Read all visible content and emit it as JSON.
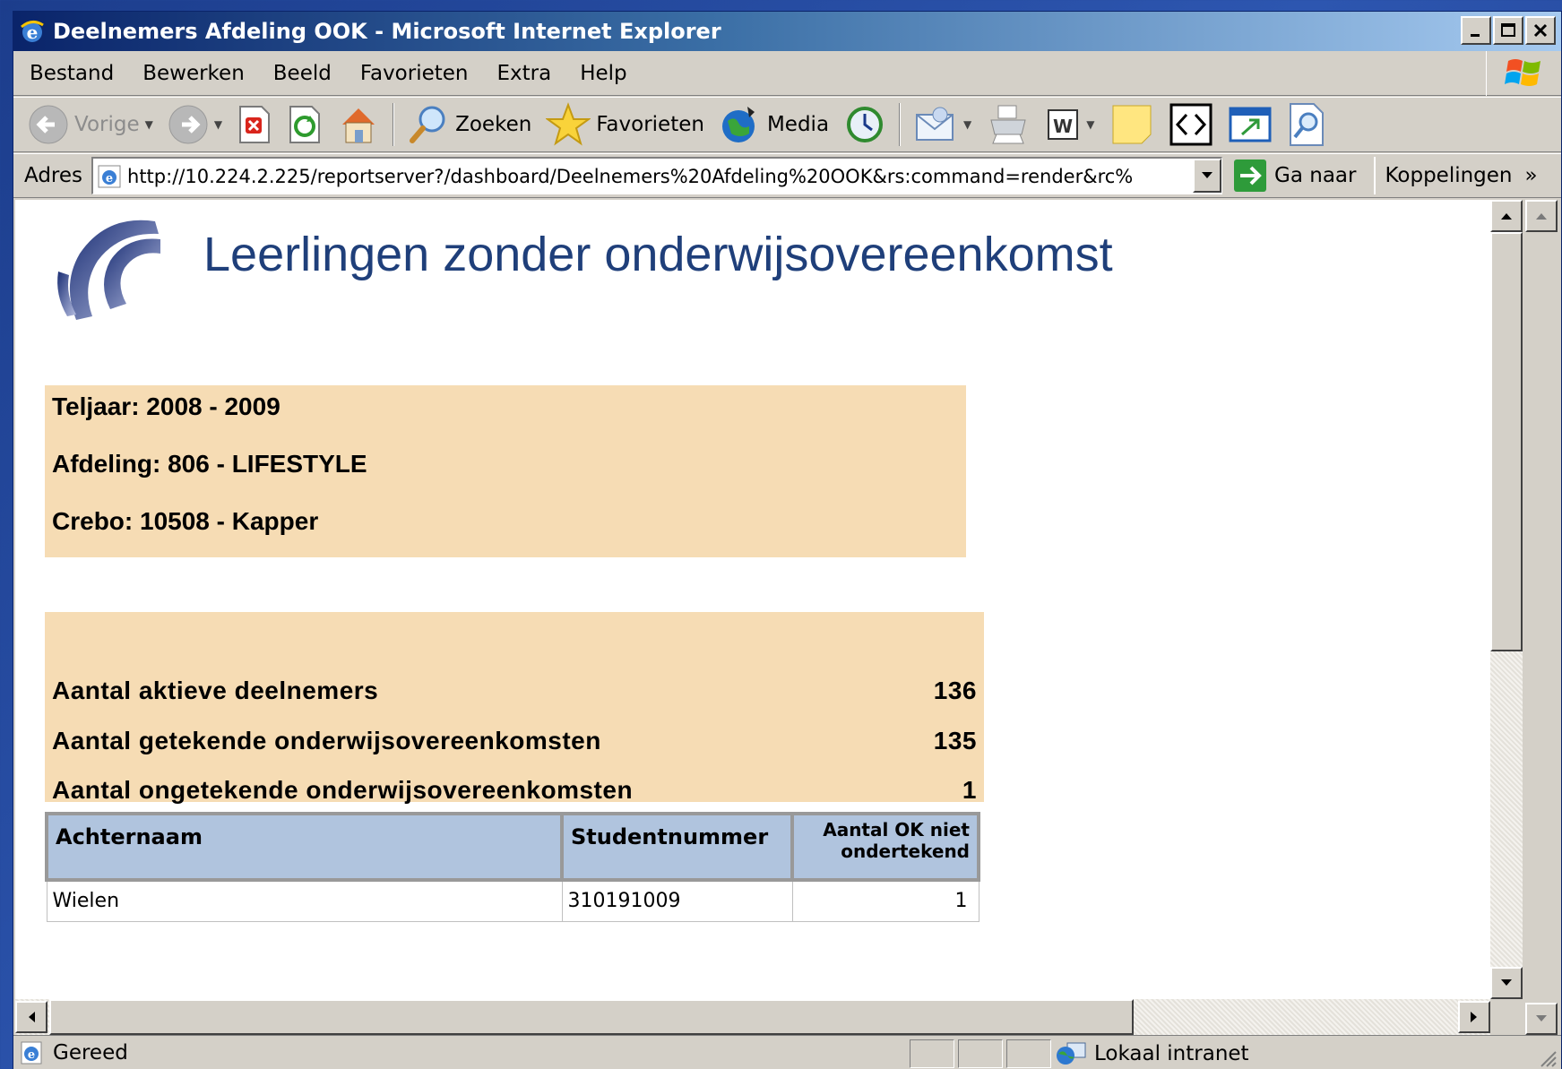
{
  "window": {
    "title": "Deelnemers Afdeling OOK - Microsoft Internet Explorer",
    "minimize": "_",
    "maximize": "□",
    "close": "✕"
  },
  "menu": {
    "items": [
      {
        "label": "Bestand"
      },
      {
        "label": "Bewerken"
      },
      {
        "label": "Beeld"
      },
      {
        "label": "Favorieten"
      },
      {
        "label": "Extra"
      },
      {
        "label": "Help"
      }
    ]
  },
  "toolbar": {
    "back_label": "Vorige",
    "search_label": "Zoeken",
    "favorites_label": "Favorieten",
    "media_label": "Media"
  },
  "address": {
    "label": "Adres",
    "url": "http://10.224.2.225/reportserver?/dashboard/Deelnemers%20Afdeling%20OOK&rs:command=render&rc%",
    "go_label": "Ga naar",
    "links_label": "Koppelingen",
    "links_chevron": "»"
  },
  "report": {
    "title": "Leerlingen zonder onderwijsovereenkomst",
    "info": {
      "teljaar": "Teljaar: 2008 - 2009",
      "afdeling": "Afdeling: 806 - LIFESTYLE",
      "crebo": "Crebo: 10508 - Kapper"
    },
    "stats": [
      {
        "label": "Aantal aktieve deelnemers",
        "value": "136"
      },
      {
        "label": "Aantal getekende onderwijsovereenkomsten",
        "value": "135"
      },
      {
        "label": "Aantal ongetekende onderwijsovereenkomsten",
        "value": "1"
      }
    ],
    "table": {
      "headers": {
        "achternaam": "Achternaam",
        "studentnummer": "Studentnummer",
        "aantal_line1": "Aantal OK niet",
        "aantal_line2": "ondertekend"
      },
      "rows": [
        {
          "achternaam": "Wielen",
          "studentnummer": "310191009",
          "aantal": "1"
        }
      ]
    }
  },
  "status": {
    "text": "Gereed",
    "zone": "Lokaal intranet"
  },
  "colors": {
    "title_blue": "#1f3f7a",
    "info_bg": "#f6dcb4",
    "table_header_bg": "#b0c4de"
  }
}
